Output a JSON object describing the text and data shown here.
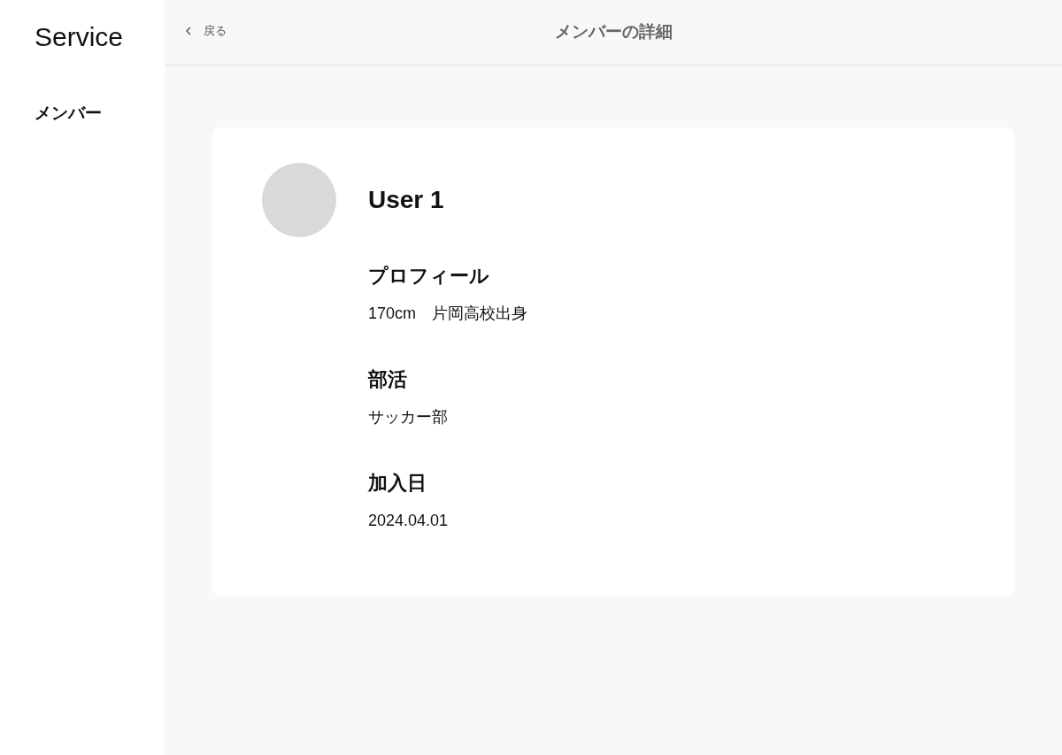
{
  "sidebar": {
    "logo": "Service",
    "items": [
      {
        "label": "メンバー"
      }
    ]
  },
  "header": {
    "back": {
      "label": "戻る"
    },
    "title": "メンバーの詳細"
  },
  "member": {
    "name": "User 1",
    "fields": [
      {
        "label": "プロフィール",
        "value": "170cm　片岡高校出身"
      },
      {
        "label": "部活",
        "value": "サッカー部"
      },
      {
        "label": "加入日",
        "value": "2024.04.01"
      }
    ]
  }
}
